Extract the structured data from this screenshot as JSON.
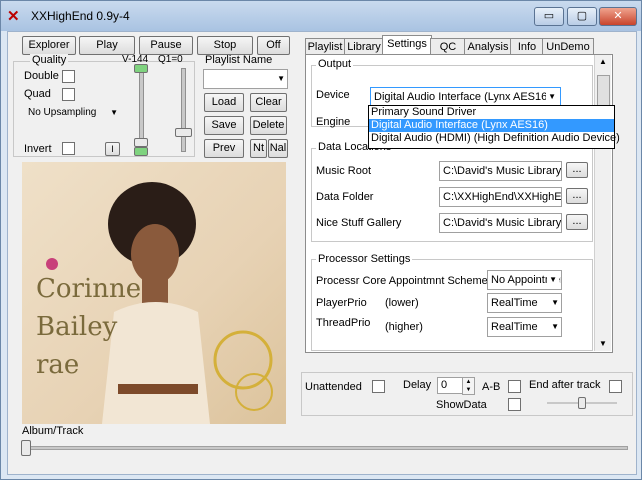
{
  "window": {
    "title": "XXHighEnd 0.9y-4",
    "minimize": "▭",
    "maximize": "▢",
    "close": "✕"
  },
  "toolbar": {
    "explorer": "Explorer",
    "play": "Play",
    "pause": "Pause",
    "stop": "Stop",
    "off": "Off"
  },
  "quality": {
    "label": "Quality",
    "double": "Double",
    "quad": "Quad",
    "upsampling": "No Upsampling",
    "invert": "Invert",
    "v_label": "V-144",
    "q_label": "Q1=0",
    "small_btn": "I"
  },
  "playlist": {
    "title": "Playlist Name",
    "load": "Load",
    "clear": "Clear",
    "save": "Save",
    "delete": "Delete",
    "prev": "Prev",
    "nt": "Nt",
    "nal": "Nal"
  },
  "album": {
    "artist_line1": "Corinne",
    "artist_line2": "Bailey",
    "artist_line3": "rae"
  },
  "tabs": [
    "Playlist",
    "Library",
    "Settings",
    "QC",
    "Analysis",
    "Info",
    "UnDemo"
  ],
  "settings": {
    "output_title": "Output",
    "device_label": "Device",
    "device_value": "Digital Audio Interface (Lynx AES16)",
    "engine_label": "Engine",
    "dropdown_options": [
      "Primary Sound Driver",
      "Digital Audio Interface (Lynx AES16)",
      "Digital Audio (HDMI) (High Definition Audio Device)"
    ],
    "data_locations_title": "Data Locations",
    "music_root_label": "Music Root",
    "music_root_value": "C:\\David's Music Library",
    "data_folder_label": "Data Folder",
    "data_folder_value": "C:\\XXHighEnd\\XXHighEnd",
    "gallery_label": "Nice Stuff Gallery",
    "gallery_value": "C:\\David's Music Library",
    "browse": "...",
    "processor_title": "Processor Settings",
    "core_label": "Processr Core Appointmnt Scheme",
    "core_value": "No Appointment",
    "player_prio_label": "PlayerPrio",
    "player_prio_hint": "(lower)",
    "player_prio_value": "RealTime",
    "thread_prio_label": "ThreadPrio",
    "thread_prio_hint": "(higher)",
    "thread_prio_value": "RealTime"
  },
  "bottom": {
    "unattended": "Unattended",
    "delay": "Delay",
    "delay_value": "0",
    "ab": "A-B",
    "end_after_track": "End after track",
    "show_data": "ShowData",
    "album_track": "Album/Track"
  },
  "colors": {
    "accent": "#3399ff",
    "title_gradient": "#a9c3e2"
  }
}
